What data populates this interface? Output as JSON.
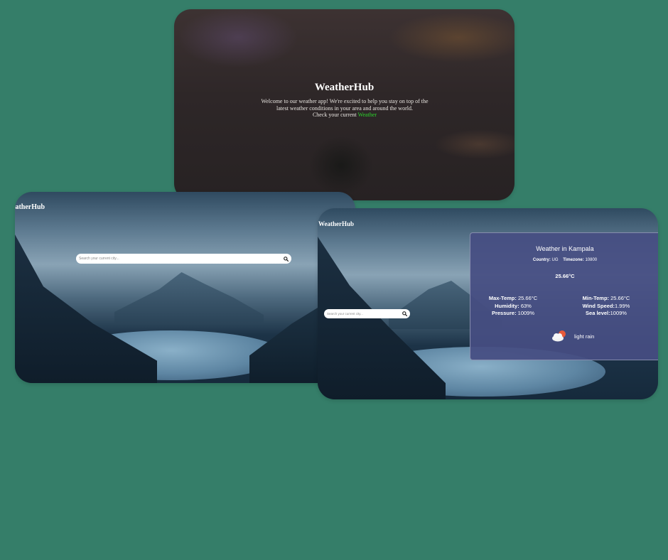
{
  "landing": {
    "title": "WeatherHub",
    "line1": "Welcome to our weather app! We're excited to help you stay on top of the",
    "line2": "latest weather conditions in your area and around the world.",
    "cta_text": "Check your current ",
    "cta_link": "Weather",
    "link_color": "#2bd42b"
  },
  "search_view": {
    "logo": "eatherHub",
    "search_placeholder": "Search your current city...",
    "search_icon": "magnifier-icon"
  },
  "results_view": {
    "logo": "WeatherHub",
    "search_placeholder": "Search your current city...",
    "search_icon": "magnifier-icon",
    "panel": {
      "heading": "Weather in Kampala",
      "country_label": "Country:",
      "country_value": "UG",
      "timezone_label": "Timezone:",
      "timezone_value": "10800",
      "temperature": "25.66°C",
      "max_temp_label": "Max-Temp:",
      "max_temp_value": "25.66°C",
      "humidity_label": "Humidity:",
      "humidity_value": "63%",
      "pressure_label": "Pressure:",
      "pressure_value": "1009%",
      "min_temp_label": "Min-Temp:",
      "min_temp_value": "25.66°C",
      "wind_label": "Wind Speed:",
      "wind_value": "1.99%",
      "sea_label": "Sea level:",
      "sea_value": "1009%",
      "condition": "light rain",
      "condition_icon": "cloud-sun-icon"
    }
  },
  "colors": {
    "background": "#357e69",
    "panel": "#464e82"
  }
}
